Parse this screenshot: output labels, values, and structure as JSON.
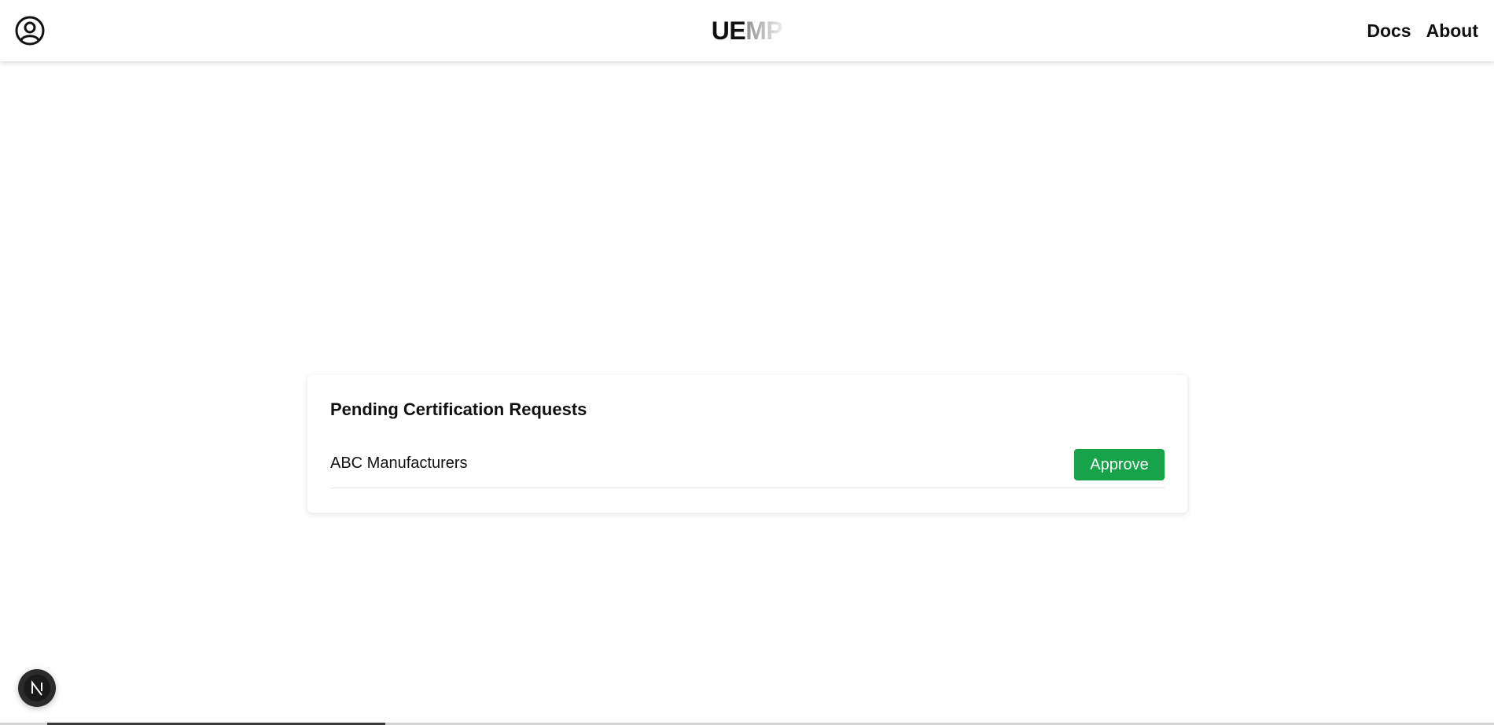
{
  "app": {
    "brand_solid": "UE",
    "brand_fade": "MP"
  },
  "header": {
    "profile_icon": "user-circle-icon",
    "nav_links": [
      {
        "label": "Docs"
      },
      {
        "label": "About"
      }
    ]
  },
  "main": {
    "card_title": "Pending Certification Requests",
    "requests": [
      {
        "name": "ABC Manufacturers",
        "action_label": "Approve"
      }
    ]
  },
  "dev_badge": {
    "label": "N",
    "icon": "nextjs-logo-icon"
  },
  "colors": {
    "approve_button": "#16a34a",
    "text": "#111111",
    "badge_bg": "#2b2b2b"
  }
}
